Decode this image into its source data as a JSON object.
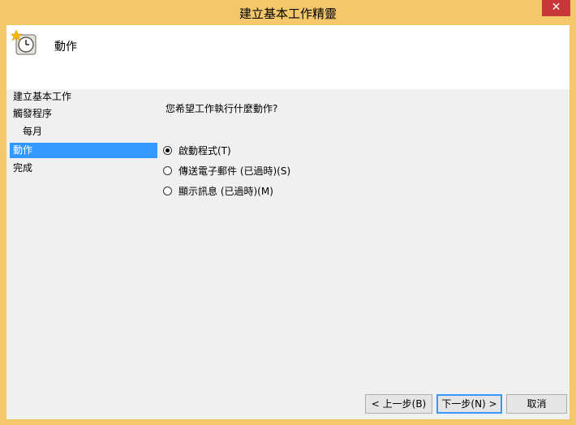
{
  "window": {
    "title": "建立基本工作精靈",
    "close_glyph": "✕"
  },
  "header": {
    "title": "動作",
    "icon": "clock-wizard-icon"
  },
  "steps": [
    {
      "label": "建立基本工作",
      "selected": false
    },
    {
      "label": "觸發程序",
      "selected": false
    },
    {
      "label": "每月",
      "selected": false
    },
    {
      "label": "動作",
      "selected": true
    },
    {
      "label": "完成",
      "selected": false
    }
  ],
  "main": {
    "question": "您希望工作執行什麼動作?",
    "options": [
      {
        "label": "啟動程式(T)",
        "checked": true
      },
      {
        "label": "傳送電子郵件 (已過時)(S)",
        "checked": false
      },
      {
        "label": "顯示訊息 (已過時)(M)",
        "checked": false
      }
    ]
  },
  "buttons": {
    "back": "< 上一步(B)",
    "next": "下一步(N) >",
    "cancel": "取消"
  }
}
